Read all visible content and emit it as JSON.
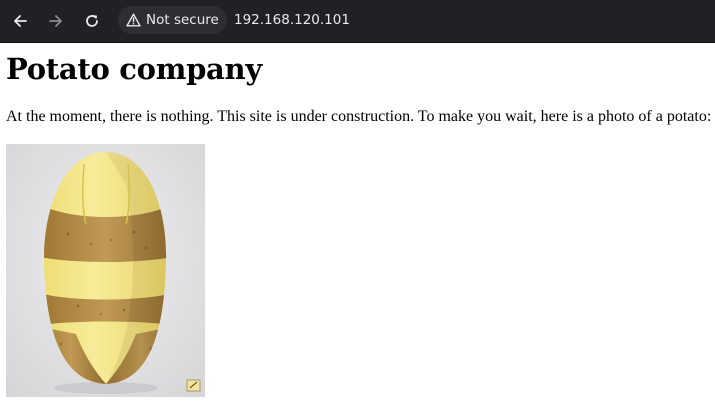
{
  "browser": {
    "security_label": "Not secure",
    "url": "192.168.120.101",
    "icons": {
      "back": "arrow-left",
      "forward": "arrow-right",
      "reload": "circular-arrow",
      "security": "warning-triangle"
    },
    "colors": {
      "toolbar": "#202124",
      "chip": "#2d2e31",
      "text": "#e8eaed",
      "forward_disabled": "#8a8c90"
    }
  },
  "page": {
    "title": "Potato company",
    "message": "At the moment, there is nothing. This site is under construction. To make you wait, here is a photo of a potato:",
    "image": {
      "subject": "potato-in-bikini",
      "colors": {
        "flesh": "#f0e27a",
        "skin": "#b9924a",
        "background": "#e4e4e6"
      }
    }
  }
}
